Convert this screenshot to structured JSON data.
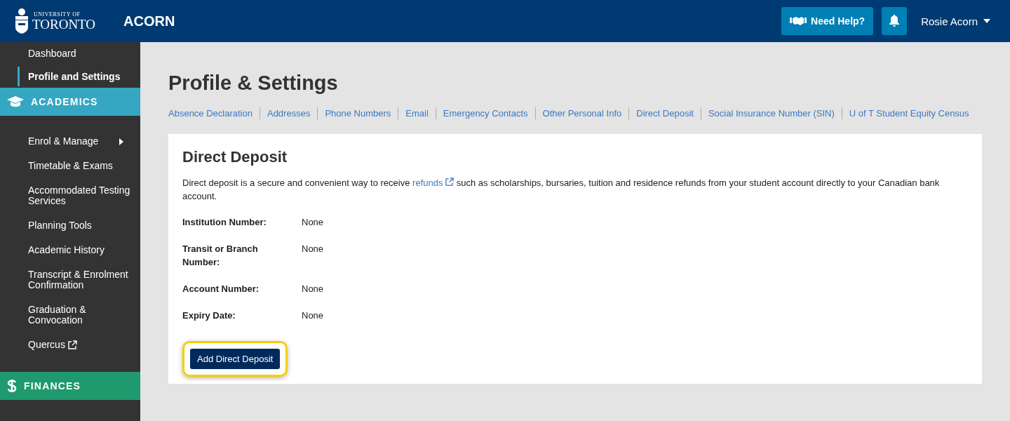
{
  "header": {
    "logo_small": "UNIVERSITY OF",
    "logo_large": "TORONTO",
    "app_name": "ACORN",
    "help_button": "Need Help?",
    "user_name": "Rosie Acorn"
  },
  "sidebar": {
    "top_items": [
      {
        "label": "Dashboard",
        "selected": false
      },
      {
        "label": "Profile and Settings",
        "selected": true
      }
    ],
    "sections": [
      {
        "title": "ACADEMICS",
        "kind": "academics",
        "color": "#36a7c2",
        "items": [
          {
            "label": "Enrol & Manage",
            "kind": "submenu"
          },
          {
            "label": "Timetable & Exams",
            "kind": "plain"
          },
          {
            "label": "Accommodated Testing Services",
            "kind": "plain"
          },
          {
            "label": "Planning Tools",
            "kind": "plain"
          },
          {
            "label": "Academic History",
            "kind": "plain"
          },
          {
            "label": "Transcript & Enrolment Confirmation",
            "kind": "plain"
          },
          {
            "label": "Graduation & Convocation",
            "kind": "plain"
          },
          {
            "label": "Quercus",
            "kind": "external"
          }
        ]
      },
      {
        "title": "FINANCES",
        "kind": "finances",
        "color": "#1f9a6e"
      }
    ]
  },
  "page_title": "Profile & Settings",
  "subnav": [
    "Absence Declaration",
    "Addresses",
    "Phone Numbers",
    "Email",
    "Emergency Contacts",
    "Other Personal Info",
    "Direct Deposit",
    "Social Insurance Number (SIN)",
    "U of T Student Equity Census"
  ],
  "card": {
    "title": "Direct Deposit",
    "intro_before": "Direct deposit is a secure and convenient way to receive",
    "link": "refunds",
    "intro_after": "such as scholarships, bursaries, tuition and residence refunds from your student account directly to your Canadian bank account.",
    "fields": [
      {
        "label": "Institution Number:",
        "value": "None"
      },
      {
        "label": "Transit or Branch Number:",
        "value": "None"
      },
      {
        "label": "Account Number:",
        "value": "None"
      },
      {
        "label": "Expiry Date:",
        "value": "None"
      }
    ],
    "button": "Add Direct Deposit",
    "button_highlighted": true
  }
}
